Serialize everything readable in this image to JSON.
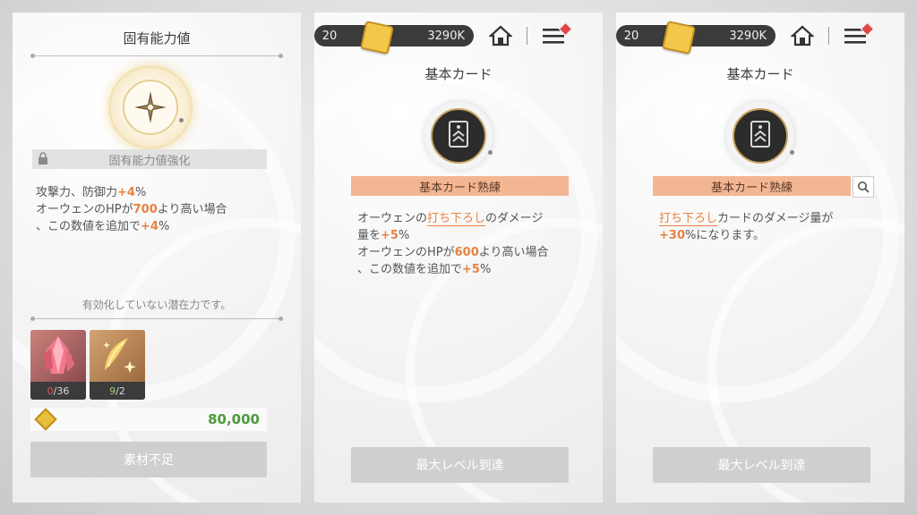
{
  "panel1": {
    "title": "固有能力値",
    "lock_label": "固有能力値強化",
    "desc_l1a": "攻撃力、防御力",
    "desc_l1b": "+4",
    "desc_l1c": "%",
    "desc_l2a": "オーウェンのHPが",
    "desc_l2b": "700",
    "desc_l2c": "より高い場合",
    "desc_l3a": "、この数値を追加で",
    "desc_l3b": "+4",
    "desc_l3c": "%",
    "inactive_note": "有効化していない潜在力です。",
    "items": [
      {
        "have": "0",
        "need": "/36"
      },
      {
        "have": "9",
        "need": "/2"
      }
    ],
    "cost": "80,000",
    "button": "素材不足"
  },
  "topbar": {
    "level": "20",
    "currency": "3290K"
  },
  "panel2": {
    "title": "基本カード",
    "bar": "基本カード熟練",
    "l1a": "オーウェンの",
    "l1b": "打ち下ろし",
    "l1c": "のダメージ",
    "l2a": "量を",
    "l2b": "+5",
    "l2c": "%",
    "l3a": "オーウェンのHPが",
    "l3b": "600",
    "l3c": "より高い場合",
    "l4a": "、この数値を追加で",
    "l4b": "+5",
    "l4c": "%",
    "button": "最大レベル到達"
  },
  "panel3": {
    "title": "基本カード",
    "bar": "基本カード熟練",
    "l1a": "打ち下ろし",
    "l1b": "カードのダメージ量が",
    "l2a": "+30",
    "l2b": "%になります。",
    "button": "最大レベル到達"
  },
  "icons": {
    "home": "home-icon",
    "menu": "menu-icon",
    "search": "search-icon",
    "lock": "lock-icon",
    "coin": "coin-icon"
  },
  "colors": {
    "highlight": "#e8813f",
    "bar": "#f3b692",
    "cost": "#4c9a3c"
  }
}
